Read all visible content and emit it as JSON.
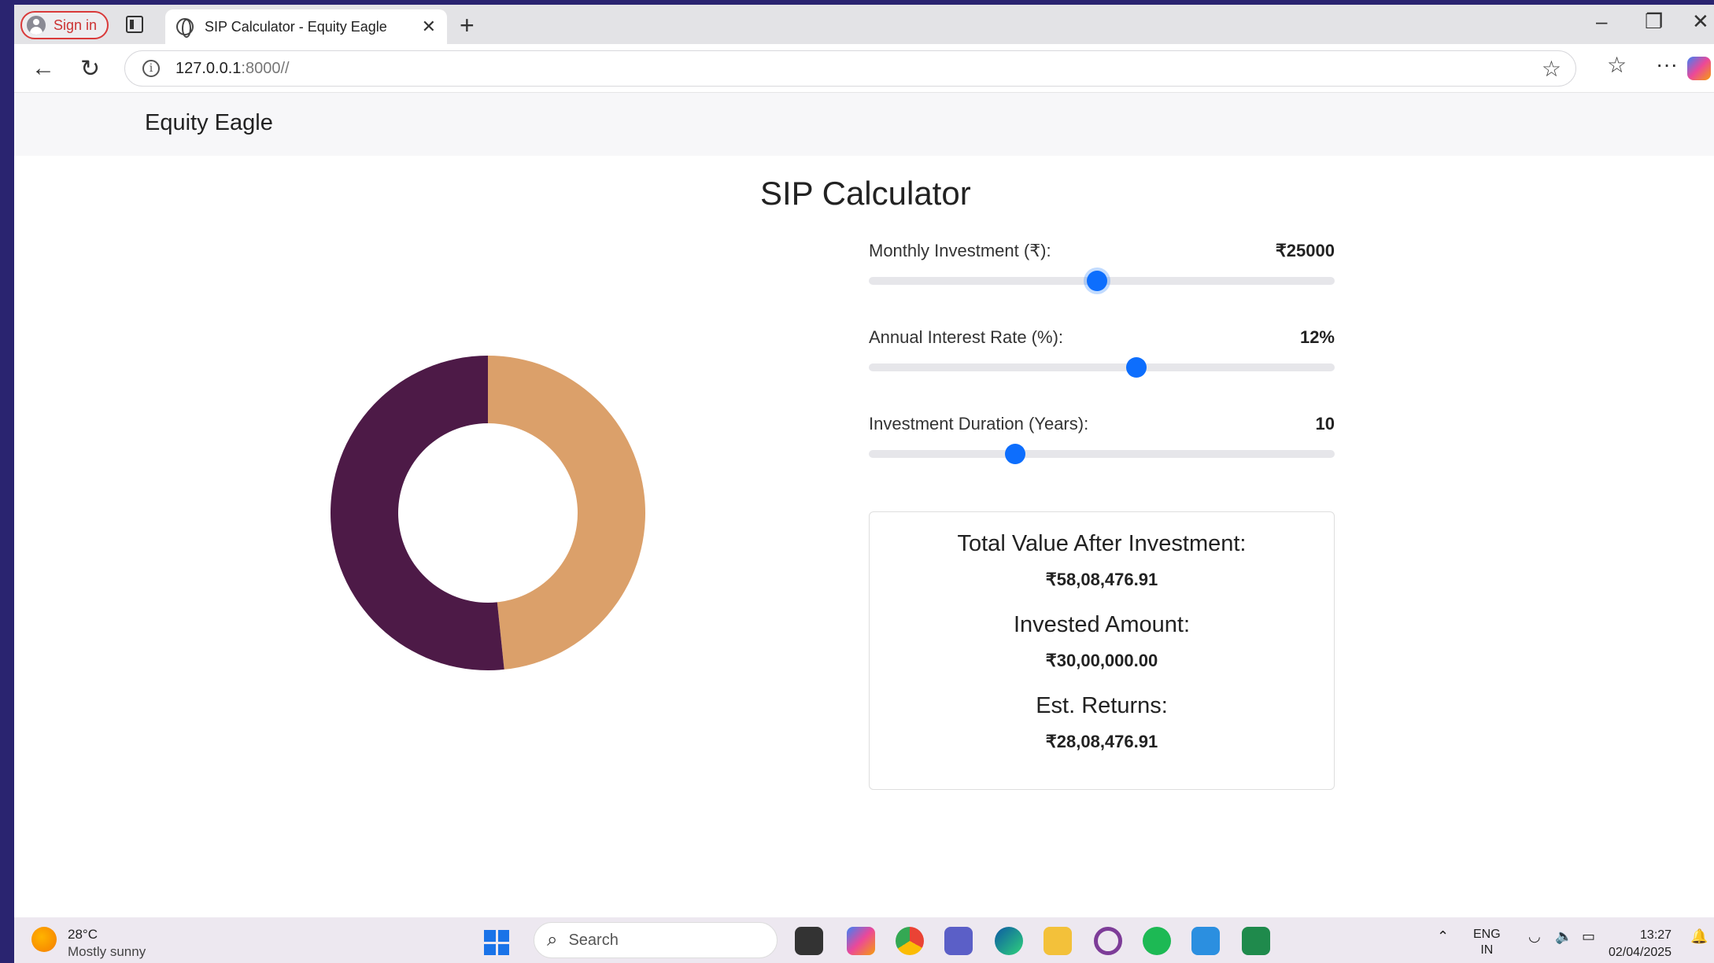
{
  "browser": {
    "sign_in_label": "Sign in",
    "tab_title": "SIP Calculator - Equity Eagle",
    "url_host": "127.0.0.1",
    "url_rest": ":8000//"
  },
  "page": {
    "brand": "Equity Eagle",
    "heading": "SIP Calculator"
  },
  "sliders": [
    {
      "label": "Monthly Investment (₹):",
      "value_text": "₹25000",
      "position": 0.49
    },
    {
      "label": "Annual Interest Rate (%):",
      "value_text": "12%",
      "position": 0.575
    },
    {
      "label": "Investment Duration (Years):",
      "value_text": "10",
      "position": 0.315
    }
  ],
  "results": {
    "total_label": "Total Value After Investment:",
    "total_value": "₹58,08,476.91",
    "invested_label": "Invested Amount:",
    "invested_value": "₹30,00,000.00",
    "returns_label": "Est. Returns:",
    "returns_value": "₹28,08,476.91"
  },
  "chart_data": {
    "type": "pie",
    "series": [
      {
        "values": [
          3000000,
          2808476.91
        ],
        "colors": [
          "#4d1a47",
          "#dba06a"
        ]
      }
    ]
  },
  "taskbar": {
    "weather_temp": "28°C",
    "weather_desc": "Mostly sunny",
    "search_placeholder": "Search",
    "lang_top": "ENG",
    "lang_bottom": "IN",
    "time": "13:27",
    "date": "02/04/2025"
  }
}
